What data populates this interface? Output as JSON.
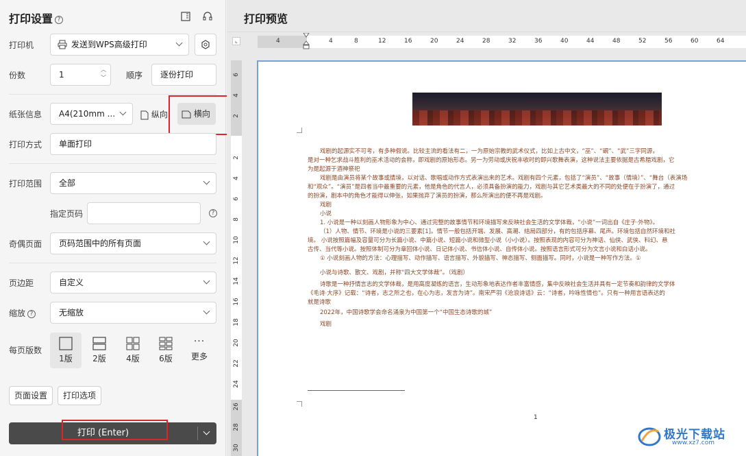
{
  "settings": {
    "title": "打印设置",
    "help_glyph": "?",
    "printer_label": "打印机",
    "printer_value": "发送到WPS高级打印",
    "copies_label": "份数",
    "copies_value": "1",
    "order_label": "顺序",
    "order_value": "逐份打印",
    "paper_label": "纸张信息",
    "paper_value": "A4(210mm ...",
    "portrait_label": "纵向",
    "landscape_label": "横向",
    "print_mode_label": "打印方式",
    "print_mode_value": "单面打印",
    "range_label": "打印范围",
    "range_value": "全部",
    "pages_label": "指定页码",
    "pages_placeholder": "",
    "oddeven_label": "奇偶页面",
    "oddeven_value": "页码范围中的所有页面",
    "margin_label": "页边距",
    "margin_value": "自定义",
    "scale_label": "缩放",
    "scale_value": "无缩放",
    "per_page_label": "每页版数",
    "layouts": [
      "1版",
      "2版",
      "4版",
      "6版",
      "更多"
    ],
    "page_setup_button": "页面设置",
    "print_options_button": "打印选项",
    "print_button": "打印 (Enter)"
  },
  "preview": {
    "title": "打印预览",
    "ruler_h": [
      "4",
      "4",
      "8",
      "12",
      "16",
      "20",
      "24",
      "28",
      "32",
      "36",
      "40",
      "44",
      "48",
      "52",
      "56",
      "60",
      "64"
    ],
    "ruler_v_top": [
      "6",
      "4",
      "2"
    ],
    "ruler_v": [
      "2",
      "4",
      "6",
      "8",
      "10",
      "12",
      "14",
      "16",
      "18",
      "20",
      "22",
      "24",
      "26",
      "28",
      "30"
    ],
    "doc_lines": [
      "戏剧的起源实不可考，有多种假说。比较主流的看法有二，一为原始宗教的武术仪式，比如上古中文，“巫”、“覡”、“武”三字同源，",
      "是对一种乞求战斗胜利的巫术活动的会称，即戏剧的原始形态。另一为劳动或庆祝丰收时的即兴歌舞表演，这种说法主要依据是古希腊戏剧，它",
      "为是起源于酒神祭祀",
      "戏剧是由演员将某个故事或情境，以对话、歌唱或动作方式表演出来的艺术。戏剧有四个元素，包括了“演员”、“故事（情境）”、“舞台（表演场",
      "和“观众”。“演员”是四者当中最重要的元素，他是角色的代言人，必须具备扮演的能力，戏剧与其它艺术类最大的不同的处便在于扮演了，通过",
      "的扮演，剧本中的角色才能得以伸张，如果抛弃了演员的扮演，那么所演出的便不再是戏剧。",
      "戏剧",
      "小说",
      "1. 小说是一种以刻画人物形象为中心、通过完整的故事情节和环境描写来反映社会生活的文学体裁，“小说”一词出自《庄子·外物》。",
      "（1）人物、情节、环境是小说的三要素[1]。情节一般包括开端、发展、高潮、结局四部分，有的包括序幕、尾声。环境包括自然环境和社",
      "境。 小说按照篇幅及容量可分为长篇小说、中篇小说、短篇小说和微型小说（小小说）。按照表现的内容可分为神话、仙侠、武侠、科幻、悬",
      "古传、当代等小说。按照体制可分为章回体小说、日记体小说、书信体小说、自传体小说。按照语言形式可分为文言小说和白话小说。",
      "① 小说刻画人物的方法：心理描写、动作描写、语言描写、外貌描写、神态描写、侧面描写。同时，小说是一种写作方法。①",
      "小说与诗歌、散文、戏剧，并称“四大文学体裁”。（戏剧）",
      "诗歌是一种抒情言志的文学体裁，是用高度凝练的语言，生动形象地表达作者丰富情感，集中反映社会生活并具有一定节奏和韵律的文学体",
      "《毛诗·大序》记载：“诗者，志之所之也，在心为志，发言为诗”。南宋严羽《沧浪诗话》云：“诗者，吟咏性情也”。只有一种用言语表达的",
      "就是诗歌",
      "2022年，中国诗歌学会命名涌泉为中国第一个“中国生态诗歌的城”",
      "戏剧"
    ],
    "page_number": "1"
  },
  "watermark": {
    "text": "极光下载站",
    "url": "www.xz7.com"
  },
  "colors": {
    "highlight_red": "#d9262a",
    "print_button_bg": "#4a4a4a"
  }
}
